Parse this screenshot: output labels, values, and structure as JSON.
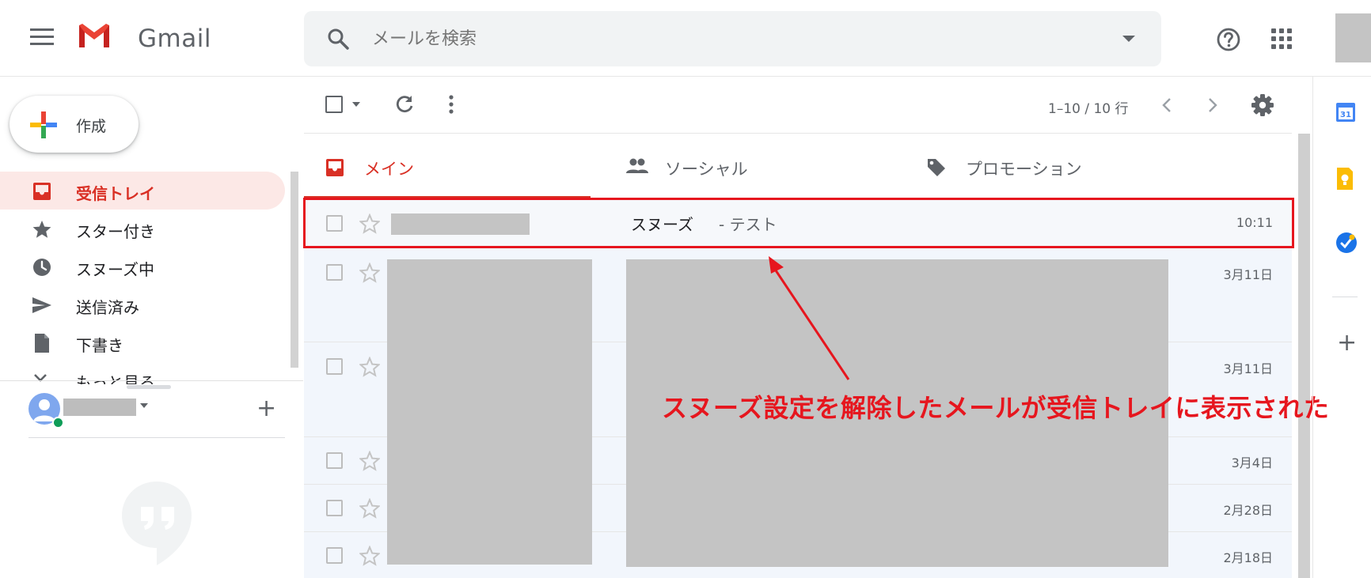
{
  "app": {
    "name": "Gmail"
  },
  "search": {
    "placeholder": "メールを検索"
  },
  "compose": {
    "label": "作成"
  },
  "sidebar": {
    "items": [
      {
        "label": "受信トレイ",
        "icon": "inbox-icon",
        "active": true
      },
      {
        "label": "スター付き",
        "icon": "star-icon",
        "active": false
      },
      {
        "label": "スヌーズ中",
        "icon": "clock-icon",
        "active": false
      },
      {
        "label": "送信済み",
        "icon": "send-icon",
        "active": false
      },
      {
        "label": "下書き",
        "icon": "draft-icon",
        "active": false
      }
    ],
    "more_label": "もっと見る"
  },
  "toolbar": {
    "pager": "1–10 / 10 行"
  },
  "tabs": [
    {
      "label": "メイン",
      "icon": "inbox-icon",
      "active": true
    },
    {
      "label": "ソーシャル",
      "icon": "people-icon",
      "active": false
    },
    {
      "label": "プロモーション",
      "icon": "tag-icon",
      "active": false
    }
  ],
  "emails": [
    {
      "subject": "スヌーズ",
      "snippet": "- テスト",
      "date": "10:11"
    },
    {
      "subject": "",
      "snippet": "",
      "date": "3月11日"
    },
    {
      "subject": "",
      "snippet": "",
      "date": "3月11日"
    },
    {
      "subject": "",
      "snippet": "",
      "date": "3月4日"
    },
    {
      "subject": "",
      "snippet": "",
      "date": "2月28日"
    },
    {
      "subject": "",
      "snippet": "",
      "date": "2月18日"
    }
  ],
  "annotation": {
    "text": "スヌーズ設定を解除したメールが受信トレイに表示された"
  },
  "colors": {
    "brand_red": "#d93025",
    "annotation_red": "#e6161e",
    "active_bg": "#fce8e6",
    "search_bg": "#f1f3f4"
  }
}
